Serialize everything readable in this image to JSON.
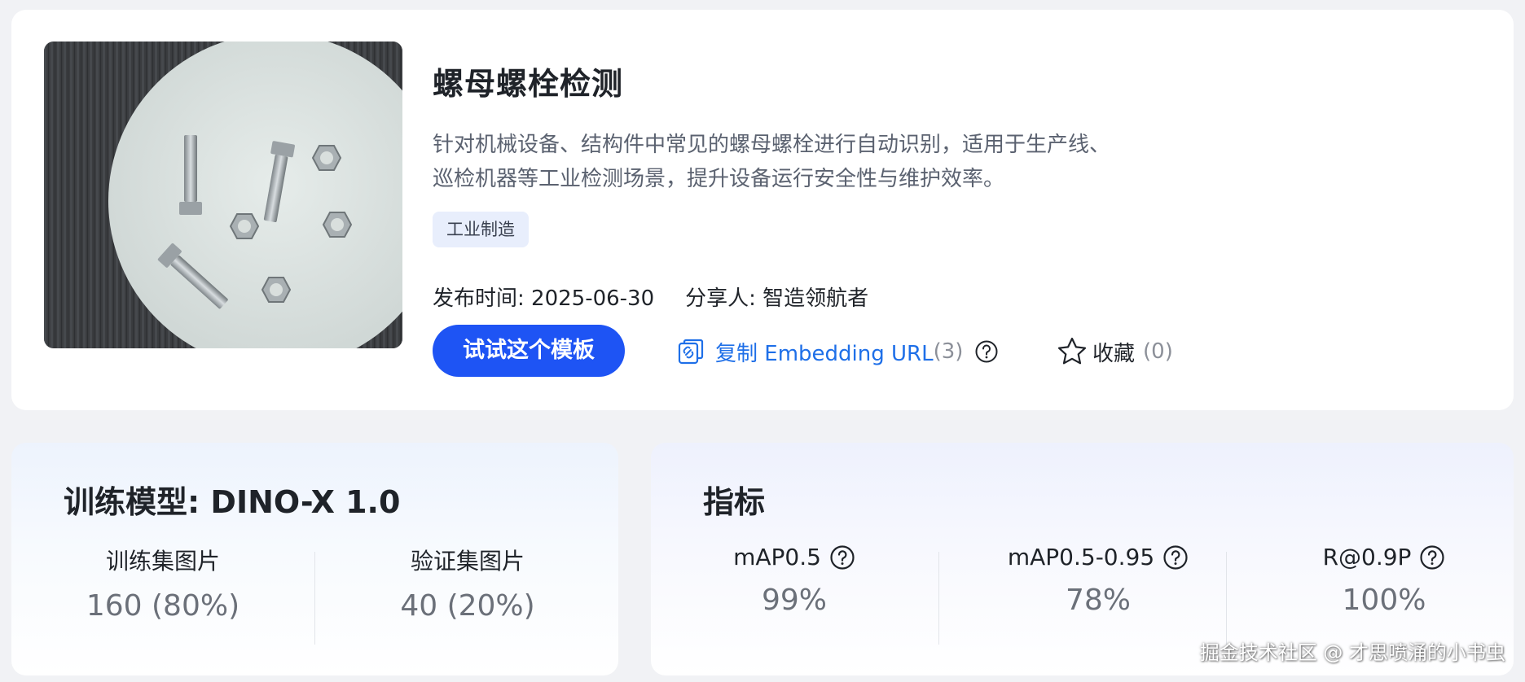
{
  "template": {
    "title": "螺母螺栓检测",
    "description_line1": "针对机械设备、结构件中常见的螺母螺栓进行自动识别，适用于生产线、",
    "description_line2": "巡检机器等工业检测场景，提升设备运行安全性与维护效率。",
    "tag": "工业制造",
    "publish_label": "发布时间: ",
    "publish_date": "2025-06-30",
    "sharer_label": "分享人: ",
    "sharer": "智造领航者",
    "thumbnail_icon": "bolts-and-nuts-photo"
  },
  "actions": {
    "try_label": "试试这个模板",
    "copy_label": "复制 Embedding URL",
    "copy_count": "(3)",
    "favorite_label": "收藏",
    "favorite_count": "(0)",
    "copy_icon": "link-icon",
    "help_icon": "question-circle-icon",
    "favorite_icon": "star-icon"
  },
  "training": {
    "title": "训练模型: DINO-X 1.0",
    "train_label": "训练集图片",
    "train_value": "160 (80%)",
    "val_label": "验证集图片",
    "val_value": "40 (20%)"
  },
  "metrics": {
    "title": "指标",
    "items": [
      {
        "label": "mAP0.5",
        "value": "99%"
      },
      {
        "label": "mAP0.5-0.95",
        "value": "78%"
      },
      {
        "label": "R@0.9P",
        "value": "100%"
      }
    ]
  },
  "watermark": "掘金技术社区 @ 才思喷涌的小书虫",
  "colors": {
    "accent": "#1e54f4",
    "link": "#1e6fe8",
    "tag_bg": "#e8eefc"
  }
}
